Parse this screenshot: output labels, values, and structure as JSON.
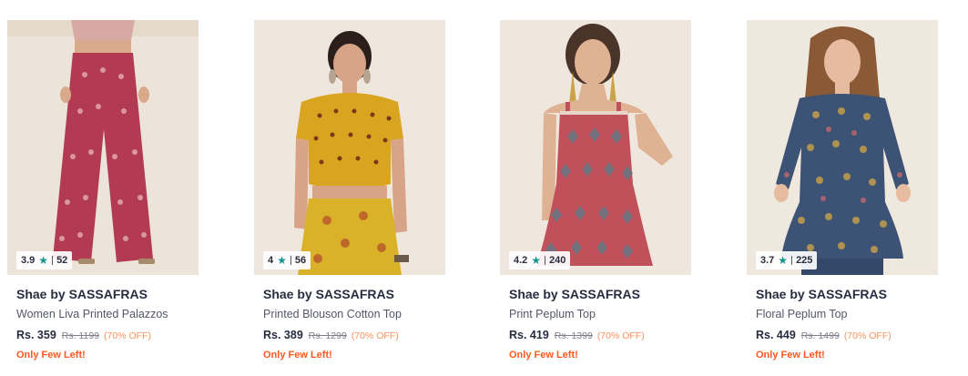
{
  "products": [
    {
      "brand": "Shae by SASSAFRAS",
      "name": "Women Liva Printed Palazzos",
      "rating": "3.9",
      "rating_count": "52",
      "price": "Rs. 359",
      "mrp": "Rs. 1199",
      "discount": "(70% OFF)",
      "stock_note": "Only Few Left!",
      "colors": {
        "main": "#b23a52",
        "accent": "#e7b9b3"
      }
    },
    {
      "brand": "Shae by SASSAFRAS",
      "name": "Printed Blouson Cotton Top",
      "rating": "4",
      "rating_count": "56",
      "price": "Rs. 389",
      "mrp": "Rs. 1299",
      "discount": "(70% OFF)",
      "stock_note": "Only Few Left!",
      "colors": {
        "main": "#d9a521",
        "accent": "#7a3a1a"
      }
    },
    {
      "brand": "Shae by SASSAFRAS",
      "name": "Print Peplum Top",
      "rating": "4.2",
      "rating_count": "240",
      "price": "Rs. 419",
      "mrp": "Rs. 1399",
      "discount": "(70% OFF)",
      "stock_note": "Only Few Left!",
      "colors": {
        "main": "#c0505a",
        "accent": "#5a7d8a"
      }
    },
    {
      "brand": "Shae by SASSAFRAS",
      "name": "Floral Peplum Top",
      "rating": "3.7",
      "rating_count": "225",
      "price": "Rs. 449",
      "mrp": "Rs. 1499",
      "discount": "(70% OFF)",
      "stock_note": "Only Few Left!",
      "colors": {
        "main": "#3d5375",
        "accent": "#c9a24a"
      }
    }
  ]
}
